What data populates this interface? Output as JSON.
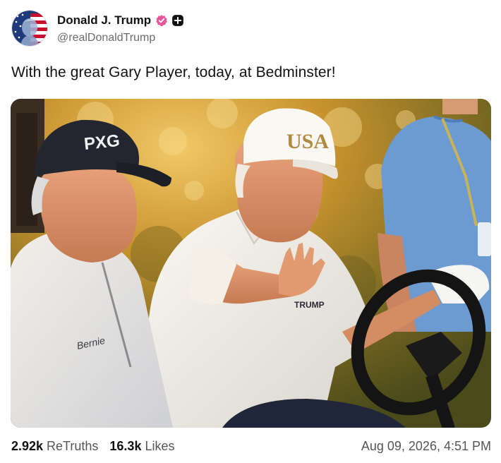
{
  "author": {
    "display_name": "Donald J. Trump",
    "handle": "@realDonaldTrump",
    "avatar_icon": "flag-portrait-avatar",
    "verified_badge_icon": "verified-badge-icon",
    "badge_color": "#e8579a",
    "plus_icon": "plus-badge-icon"
  },
  "post": {
    "text": "With the great Gary Player, today, at Bedminster!"
  },
  "media": {
    "cap_left_text": "PXG",
    "cap_right_text": "USA",
    "shirt_left_text": "Bernie",
    "shirt_right_text": "TRUMP"
  },
  "stats": {
    "retruths_value": "2.92k",
    "retruths_label": "ReTruths",
    "likes_value": "16.3k",
    "likes_label": "Likes"
  },
  "timestamp": "Aug 09, 2026, 4:51 PM"
}
